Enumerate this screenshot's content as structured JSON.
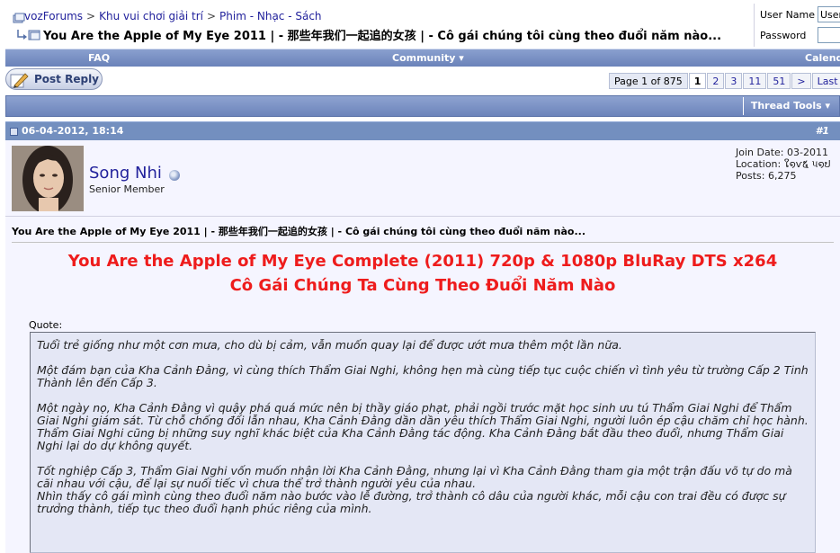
{
  "breadcrumb": {
    "items": [
      "vozForums",
      "Khu vui chơi giải trí",
      "Phim - Nhạc - Sách"
    ],
    "separator": ">"
  },
  "thread": {
    "title": "You Are the Apple of My Eye 2011 | - 那些年我们一起追的女孩 | - Cô gái chúng tôi cùng theo đuổi năm nào..."
  },
  "login": {
    "username_label": "User Name",
    "username_value": "User",
    "password_label": "Password"
  },
  "navbar": {
    "faq": "FAQ",
    "community": "Community ▾",
    "calendar": "Calend"
  },
  "post_reply": {
    "label": "Post Reply"
  },
  "pagination": {
    "label": "Page 1 of 875",
    "current": "1",
    "pages": [
      "2",
      "3",
      "11",
      "51"
    ],
    "next": ">",
    "last": "Last »"
  },
  "thread_tools": {
    "label": "Thread Tools ▾"
  },
  "post": {
    "date": "06-04-2012, 18:14",
    "number": "#1",
    "author": {
      "name": "Song Nhi",
      "title": "Senior Member",
      "join_date": "Join Date: 03-2011",
      "location": "Location: ໃ໑ѵ໕ પ໑ປ",
      "posts": "Posts: 6,275"
    },
    "title": "You Are the Apple of My Eye 2011 | - 那些年我们一起追的女孩 | - Cô gái chúng tôi cùng theo đuổi năm nào...",
    "headline_1": "You Are the Apple of My Eye Complete (2011) 720p & 1080p BluRay DTS x264",
    "headline_2": "Cô Gái Chúng Ta Cùng Theo Đuổi Năm Nào",
    "quote_label": "Quote:",
    "quote": {
      "p1": "Tuổi trẻ giống như một cơn mưa, cho dù bị cảm, vẫn muốn quay lại để được ướt mưa thêm một lần nữa.",
      "p2": "Một đám bạn của Kha Cảnh Đằng, vì cùng thích Thẩm Giai Nghi, không hẹn mà cùng tiếp tục cuộc chiến vì tình yêu từ trường Cấp 2 Tinh Thành lên đến Cấp 3.",
      "p3": "Một ngày nọ, Kha Cảnh Đằng vì quậy phá quá mức nên bị thầy giáo phạt, phải ngồi trước mặt học sinh ưu tú Thẩm Giai Nghi để Thẩm Giai Nghi giám sát. Từ chỗ chống đối lẫn nhau, Kha Cảnh Đằng dần dần yêu thích Thẩm Giai Nghi, người luôn ép cậu chăm chỉ học hành. Thẩm Giai Nghi cũng bị những suy nghĩ khác biệt của Kha Cảnh Đằng tác động. Kha Cảnh Đằng bắt đầu theo đuổi, nhưng Thẩm Giai Nghi lại do dự không quyết.",
      "p4": "Tốt nghiệp Cấp 3, Thẩm Giai Nghi vốn muốn nhận lời Kha Cảnh Đằng, nhưng lại vì Kha Cảnh Đằng tham gia một trận đấu võ tự do mà cãi nhau với cậu, để lại sự nuối tiếc vì chưa thể trở thành người yêu của nhau.",
      "p5": "Nhìn thấy cô gái mình cùng theo đuổi năm nào bước vào lễ đường, trở thành cô dâu của người khác, mỗi cậu con trai đều có được sự trưởng thành, tiếp tục theo đuổi hạnh phúc riêng của mình."
    }
  },
  "colors": {
    "nav_blue": "#738fbf",
    "link": "#22229c",
    "headline_red": "#ee1c1c",
    "post_bg": "#f5f5ff",
    "quote_bg": "#e4e7f5"
  }
}
